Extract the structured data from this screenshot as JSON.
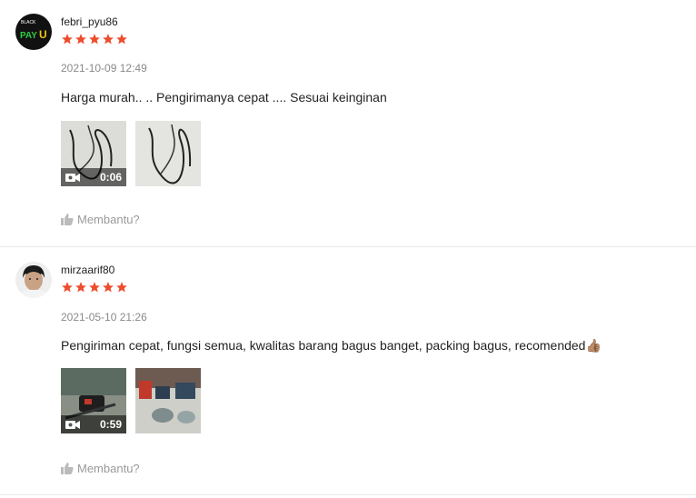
{
  "reviews": [
    {
      "username": "febri_pyu86",
      "rating": 5,
      "date": "2021-10-09 12:49",
      "comment": "Harga murah.. .. Pengirimanya cepat .... Sesuai keinginan",
      "video_duration": "0:06",
      "helpful_label": "Membantu?",
      "avatar_text": "PAY"
    },
    {
      "username": "mirzaarif80",
      "rating": 5,
      "date": "2021-05-10 21:26",
      "comment": "Pengiriman cepat, fungsi semua, kwalitas barang bagus banget, packing bagus, recomended👍🏽",
      "video_duration": "0:59",
      "helpful_label": "Membantu?"
    }
  ],
  "colors": {
    "star": "#ee4d2d",
    "muted": "#9a9a9a"
  }
}
